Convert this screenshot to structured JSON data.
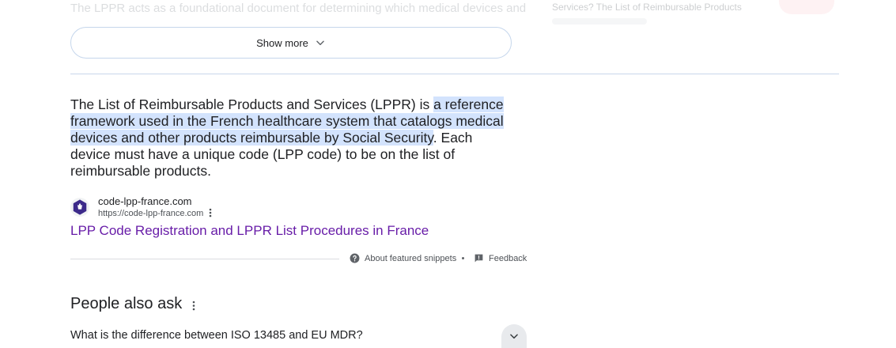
{
  "faded": {
    "paragraph": "The LPPR acts as a foundational document for determining which medical devices and",
    "card_title": "Services? The List of Reimbursable Products"
  },
  "show_more": {
    "label": "Show more"
  },
  "snippet": {
    "before": "The List of Reimbursable Products and Services (LPPR) is ",
    "highlight": "a reference framework used in the French healthcare system that catalogs medical devices and other products reimbursable by Social Security",
    "after": ". Each device must have a unique code (LPP code) to be on the list of reimbursable products."
  },
  "source": {
    "site_name": "code-lpp-france.com",
    "url": "https://code-lpp-france.com",
    "link_title": "LPP Code Registration and LPPR List Procedures in France"
  },
  "footer": {
    "about_label": "About featured snippets",
    "feedback_label": "Feedback"
  },
  "people_also_ask": {
    "title": "People also ask",
    "questions": [
      "What is the difference between ISO 13485 and EU MDR?"
    ]
  },
  "colors": {
    "highlight": "#d3e3fd",
    "visited_link": "#681da8",
    "logo": "#3c2a8a"
  }
}
